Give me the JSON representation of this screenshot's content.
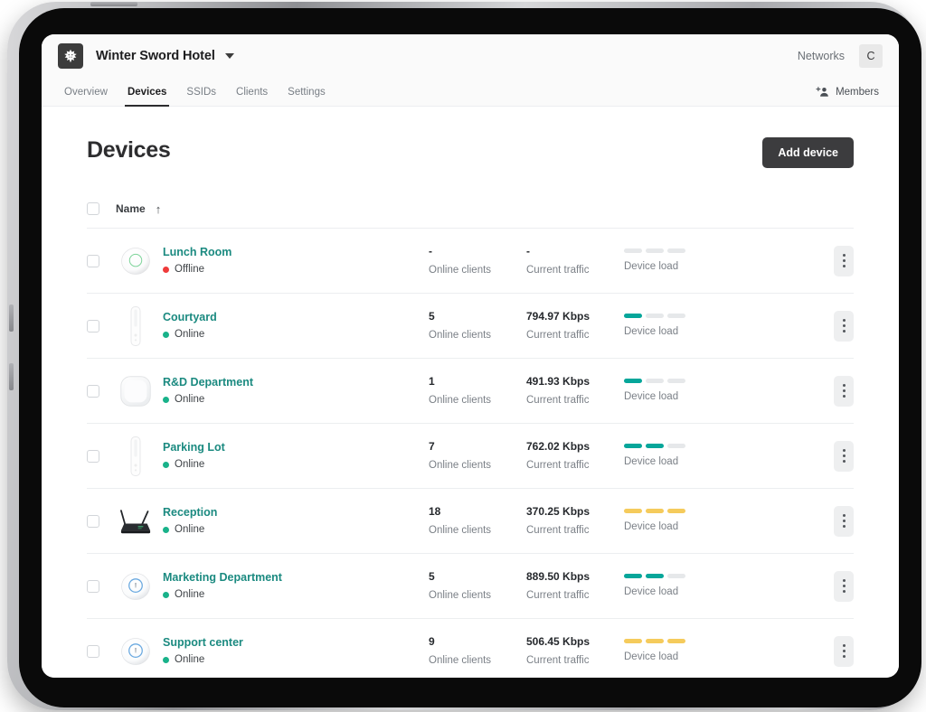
{
  "app": {
    "logo_icon": "starfish-logo-icon",
    "org_name": "Winter Sword Hotel",
    "org_caret_icon": "chevron-down-icon",
    "networks_link": "Networks",
    "account_initial": "C"
  },
  "nav": {
    "tabs": [
      {
        "label": "Overview",
        "active": false
      },
      {
        "label": "Devices",
        "active": true
      },
      {
        "label": "SSIDs",
        "active": false
      },
      {
        "label": "Clients",
        "active": false
      },
      {
        "label": "Settings",
        "active": false
      }
    ],
    "members_label": "Members",
    "members_icon": "add-member-icon"
  },
  "page": {
    "title": "Devices",
    "add_device_label": "Add device"
  },
  "table": {
    "name_column_label": "Name",
    "sort_arrow": "↑",
    "labels": {
      "clients": "Online clients",
      "traffic": "Current traffic",
      "load": "Device load"
    },
    "colors": {
      "link": "#1b8a80",
      "online_dot": "#19b28a",
      "offline_dot": "#ef3b3b",
      "load_teal": "#06a69a",
      "load_amber": "#f5cb5c",
      "load_empty": "#e6e8ea",
      "accent_dark": "#3c3c3e"
    },
    "rows": [
      {
        "name": "Lunch Room",
        "status": "Offline",
        "online": false,
        "icon": "access-point-round-green-icon",
        "clients": "-",
        "traffic": "-",
        "load_filled": 0,
        "load_total": 3,
        "load_color": "empty"
      },
      {
        "name": "Courtyard",
        "status": "Online",
        "online": true,
        "icon": "access-point-wall-white-icon",
        "clients": "5",
        "traffic": "794.97 Kbps",
        "load_filled": 1,
        "load_total": 3,
        "load_color": "teal"
      },
      {
        "name": "R&D Department",
        "status": "Online",
        "online": true,
        "icon": "access-point-square-white-icon",
        "clients": "1",
        "traffic": "491.93 Kbps",
        "load_filled": 1,
        "load_total": 3,
        "load_color": "teal"
      },
      {
        "name": "Parking Lot",
        "status": "Online",
        "online": true,
        "icon": "access-point-wall-white-icon",
        "clients": "7",
        "traffic": "762.02 Kbps",
        "load_filled": 2,
        "load_total": 3,
        "load_color": "teal"
      },
      {
        "name": "Reception",
        "status": "Online",
        "online": true,
        "icon": "router-black-antennas-icon",
        "clients": "18",
        "traffic": "370.25 Kbps",
        "load_filled": 3,
        "load_total": 3,
        "load_color": "amber"
      },
      {
        "name": "Marketing Department",
        "status": "Online",
        "online": true,
        "icon": "access-point-round-blue-icon",
        "clients": "5",
        "traffic": "889.50 Kbps",
        "load_filled": 2,
        "load_total": 3,
        "load_color": "teal"
      },
      {
        "name": "Support center",
        "status": "Online",
        "online": true,
        "icon": "access-point-round-blue-icon",
        "clients": "9",
        "traffic": "506.45 Kbps",
        "load_filled": 3,
        "load_total": 3,
        "load_color": "amber"
      }
    ],
    "row_menu_icon": "kebab-menu-icon"
  }
}
